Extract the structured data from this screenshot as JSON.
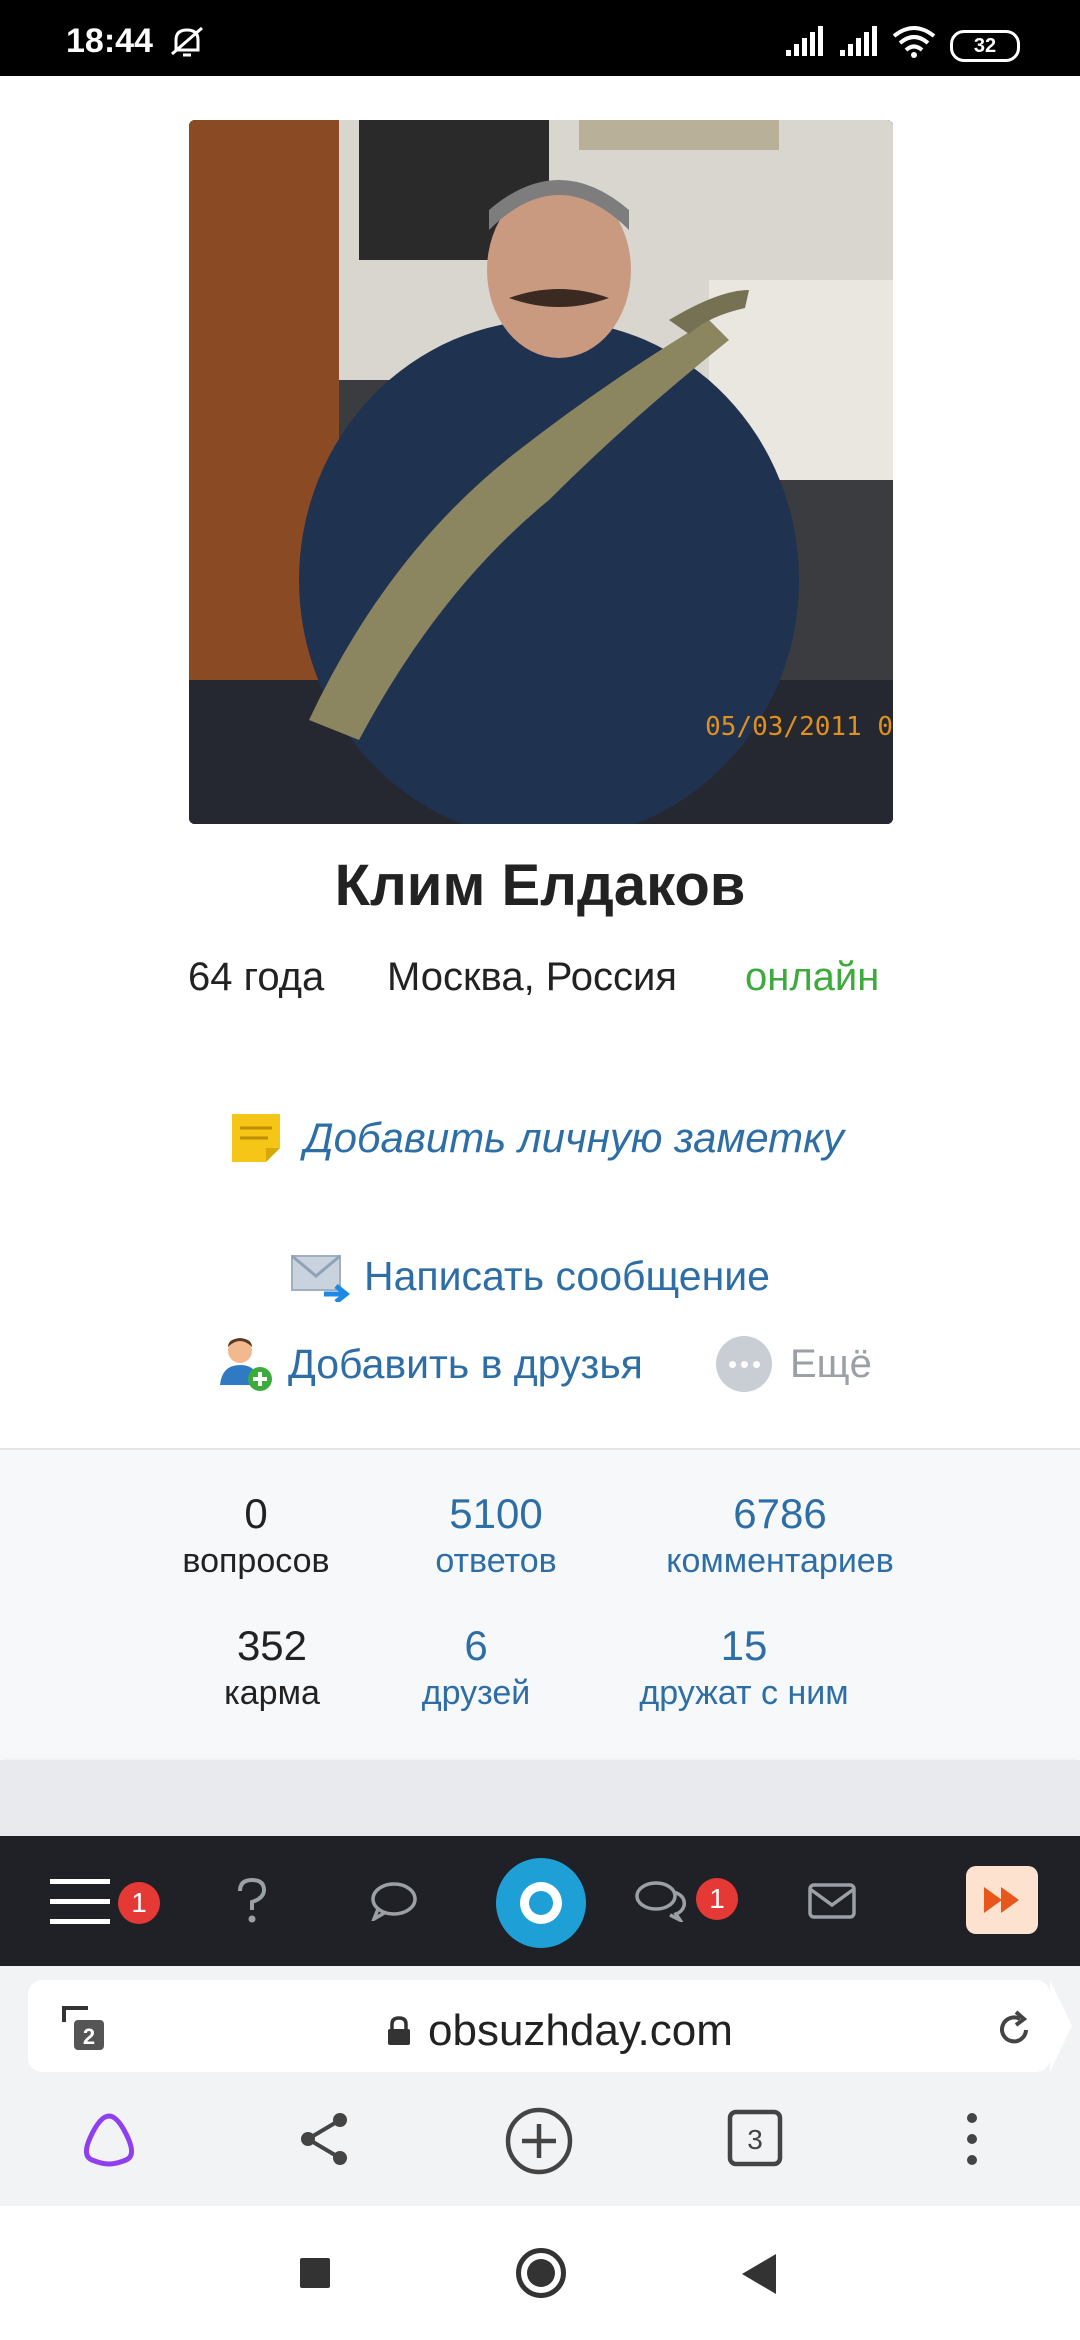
{
  "status_bar": {
    "time": "18:44",
    "battery": "32",
    "icons": [
      "mute-alarm-icon",
      "signal-icon",
      "signal-icon",
      "wifi-icon",
      "battery-icon"
    ]
  },
  "profile": {
    "name": "Клим Елдаков",
    "age": "64 года",
    "location": "Москва, Россия",
    "status": "онлайн",
    "photo_date_stamp": "05/03/2011 0",
    "status_color": "#3cab3c"
  },
  "actions": {
    "add_note": "Добавить личную заметку",
    "write_message": "Написать сообщение",
    "add_friend": "Добавить в друзья",
    "more": "Ещё"
  },
  "stats": [
    {
      "value": "0",
      "label": "вопросов",
      "style": "dark"
    },
    {
      "value": "5100",
      "label": "ответов",
      "style": "link"
    },
    {
      "value": "6786",
      "label": "комментариев",
      "style": "link"
    },
    {
      "value": "352",
      "label": "карма",
      "style": "dark"
    },
    {
      "value": "6",
      "label": "друзей",
      "style": "link"
    },
    {
      "value": "15",
      "label": "дружат с ним",
      "style": "link"
    }
  ],
  "site_nav": {
    "menu_badge": "1",
    "chats_badge": "1",
    "icons": [
      "menu-icon",
      "question-icon",
      "comment-icon",
      "site-logo",
      "chats-icon",
      "mail-icon",
      "fast-forward-icon"
    ]
  },
  "browser": {
    "url": "obsuzhday.com",
    "tab_count_small": "2",
    "tab_count": "3"
  },
  "colors": {
    "link": "#2e6ea6",
    "online": "#3cab3c",
    "badge": "#e53935",
    "site_nav_bg": "#1f2126",
    "logo": "#1ea0d7"
  }
}
